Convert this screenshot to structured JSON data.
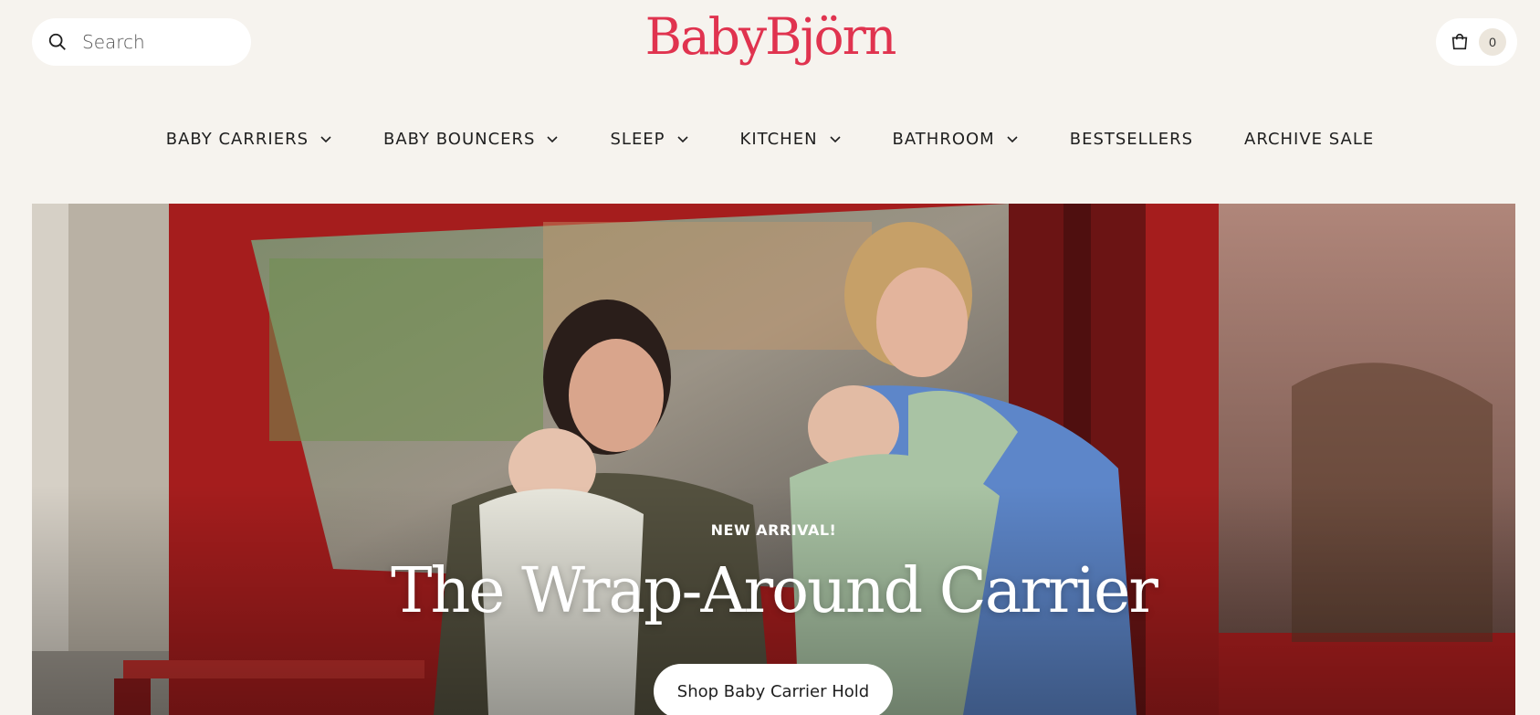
{
  "header": {
    "search_placeholder": "Search",
    "logo_text": "BabyBjörn",
    "cart_count": "0"
  },
  "nav": {
    "items": [
      {
        "label": "BABY CARRIERS",
        "has_dropdown": true
      },
      {
        "label": "BABY BOUNCERS",
        "has_dropdown": true
      },
      {
        "label": "SLEEP",
        "has_dropdown": true
      },
      {
        "label": "KITCHEN",
        "has_dropdown": true
      },
      {
        "label": "BATHROOM",
        "has_dropdown": true
      },
      {
        "label": "BESTSELLERS",
        "has_dropdown": false
      },
      {
        "label": "ARCHIVE SALE",
        "has_dropdown": false
      }
    ]
  },
  "hero": {
    "eyebrow": "NEW ARRIVAL!",
    "headline": "The Wrap-Around Carrier",
    "cta_label": "Shop Baby Carrier Hold"
  },
  "colors": {
    "page_background": "#f6f3ee",
    "brand_red": "#e0334f",
    "hero_red": "#b3201f",
    "carrier_green": "#a9c3a4"
  },
  "icons": {
    "search": "search-icon",
    "cart": "shopping-bag-icon",
    "dropdown": "chevron-down-icon"
  }
}
